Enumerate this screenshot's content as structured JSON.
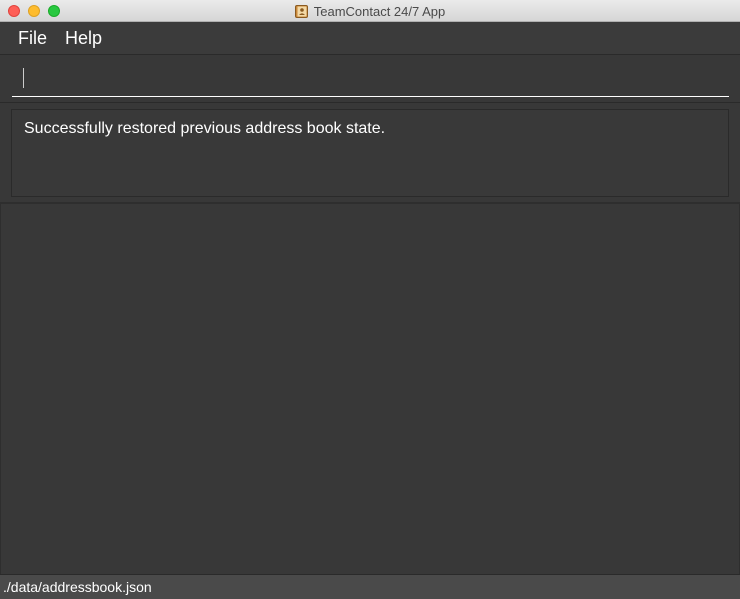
{
  "window": {
    "title": "TeamContact 24/7 App",
    "app_icon": "address-book-icon"
  },
  "menubar": {
    "items": [
      {
        "label": "File"
      },
      {
        "label": "Help"
      }
    ]
  },
  "command": {
    "value": "",
    "placeholder": ""
  },
  "result": {
    "message": "Successfully restored previous address book state."
  },
  "statusbar": {
    "path": "./data/addressbook.json"
  },
  "colors": {
    "background": "#383838",
    "text": "#ffffff",
    "close": "#fe5f57",
    "minimize": "#febc2e",
    "maximize": "#28c840"
  }
}
